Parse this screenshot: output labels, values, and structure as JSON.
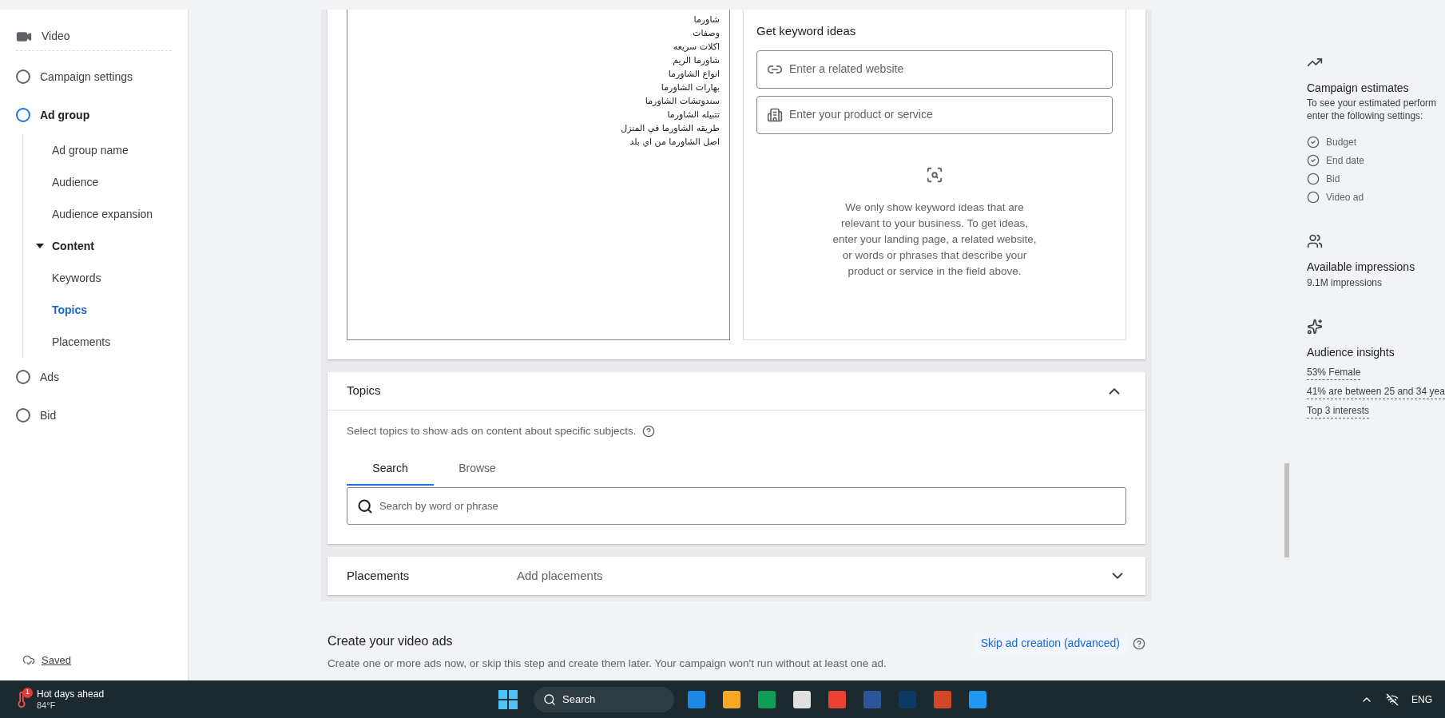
{
  "sidebar": {
    "items": [
      {
        "kind": "header",
        "label": "Video"
      },
      {
        "kind": "step",
        "label": "Campaign settings",
        "selected": false
      },
      {
        "kind": "step",
        "label": "Ad group",
        "selected": true,
        "children": [
          {
            "label": "Ad group name",
            "selected": false
          },
          {
            "label": "Audience",
            "selected": false
          },
          {
            "label": "Audience expansion",
            "selected": false
          },
          {
            "label": "Content",
            "selected": false,
            "expanded": true,
            "children": [
              {
                "label": "Keywords",
                "selected": false
              },
              {
                "label": "Topics",
                "selected": true
              },
              {
                "label": "Placements",
                "selected": false
              }
            ]
          }
        ]
      },
      {
        "kind": "step",
        "label": "Ads",
        "selected": false
      },
      {
        "kind": "step",
        "label": "Bid",
        "selected": false
      }
    ],
    "saved": "Saved"
  },
  "keywords": {
    "lines": [
      "شاورما",
      "وصفات",
      "اكلات سريعه",
      "شاورما الريم",
      "انواع الشاورما",
      "بهارات الشاورما",
      "سندوتشات الشاورما",
      "تتبيله الشاورما",
      "طريقه الشاورما في المنزل",
      "اصل الشاورما من اي بلد"
    ]
  },
  "keyword_ideas": {
    "title": "Get keyword ideas",
    "fields": [
      {
        "kind": "link",
        "placeholder": "Enter a related website"
      },
      {
        "kind": "product",
        "placeholder": "Enter your product or service"
      }
    ],
    "hint": "We only show keyword ideas that are relevant to your business. To get ideas, enter your landing page, a related website, or words or phrases that describe your product or service in the field above."
  },
  "topics": {
    "title": "Topics",
    "expanded": true,
    "description": "Select topics to show ads on content about specific subjects.",
    "tabs": [
      {
        "label": "Search",
        "selected": true
      },
      {
        "label": "Browse",
        "selected": false
      }
    ],
    "search": {
      "placeholder": "Search by word or phrase"
    }
  },
  "placements": {
    "title": "Placements",
    "value": "Add placements",
    "expanded": false
  },
  "create_ads": {
    "title": "Create your video ads",
    "description": "Create one or more ads now, or skip this step and create them later. Your campaign won't run without at least one ad.",
    "skip_link": "Skip ad creation (advanced)"
  },
  "right_panel": {
    "estimates": {
      "title": "Campaign estimates",
      "lines": [
        "To see your estimated perform",
        "enter the following settings:"
      ],
      "settings": [
        {
          "label": "Budget",
          "checked": true
        },
        {
          "label": "End date",
          "checked": true
        },
        {
          "label": "Bid",
          "checked": false
        },
        {
          "label": "Video ad",
          "checked": false
        }
      ]
    },
    "impressions": {
      "title": "Available impressions",
      "value": "9.1M impressions"
    },
    "insights": {
      "title": "Audience insights",
      "links": [
        "53% Female",
        "41% are between 25 and 34 yea",
        "Top 3 interests"
      ]
    }
  },
  "taskbar": {
    "weather": {
      "badge": "1",
      "title": "Hot days ahead",
      "temp": "84°F"
    },
    "search": "Search",
    "language": "ENG"
  }
}
